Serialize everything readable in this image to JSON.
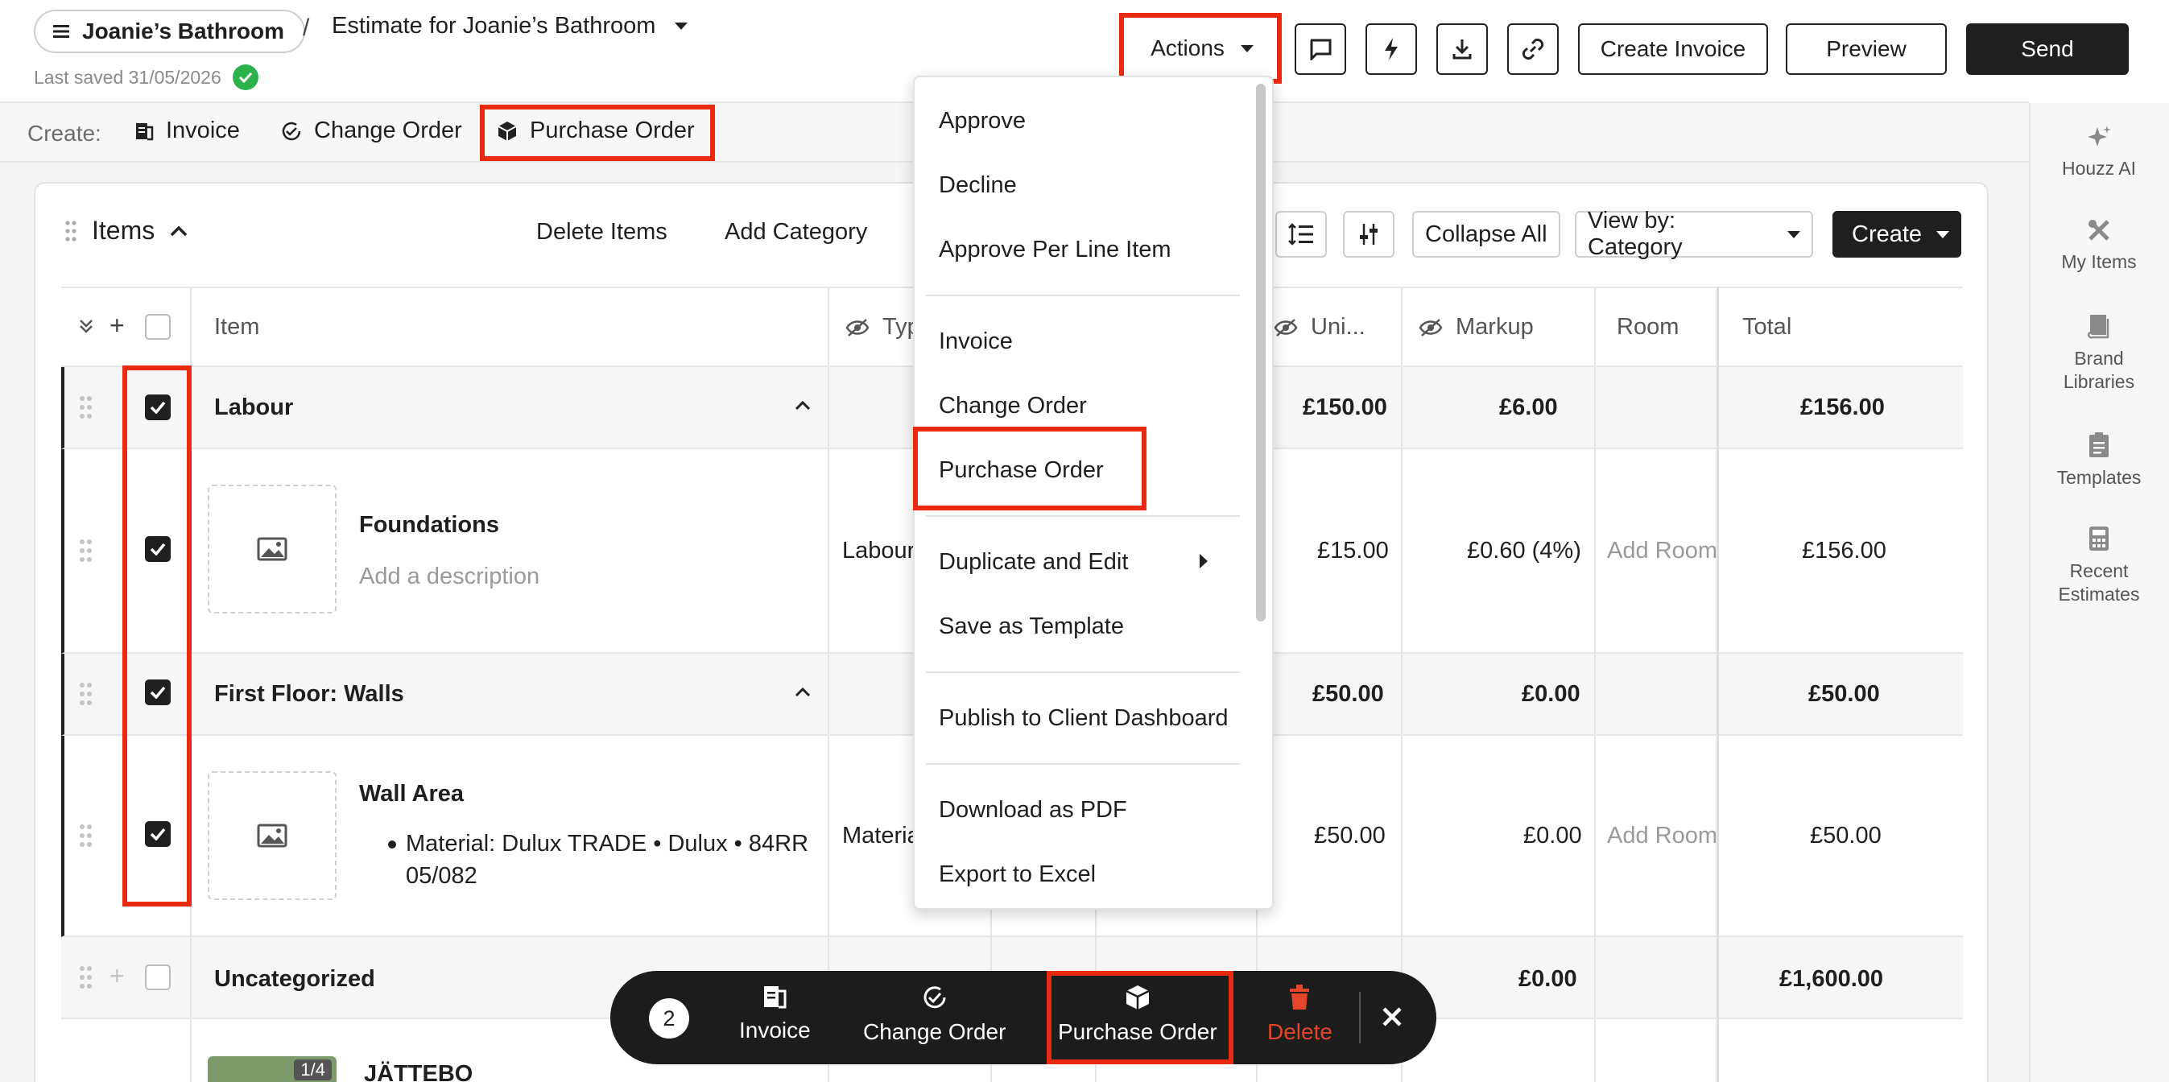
{
  "header": {
    "project_name": "Joanie’s Bathroom",
    "breadcrumb_sep": "/",
    "estimate_title": "Estimate for Joanie’s Bathroom",
    "last_saved": "Last saved 31/05/2026",
    "actions_label": "Actions",
    "create_invoice_label": "Create Invoice",
    "preview_label": "Preview",
    "send_label": "Send"
  },
  "create_row": {
    "label": "Create:",
    "invoice": "Invoice",
    "change_order": "Change Order",
    "purchase_order": "Purchase Order"
  },
  "rail": {
    "houzz_ai": "Houzz AI",
    "my_items": "My Items",
    "brand_libraries_1": "Brand",
    "brand_libraries_2": "Libraries",
    "templates": "Templates",
    "recent_estimates_1": "Recent",
    "recent_estimates_2": "Estimates"
  },
  "items_toolbar": {
    "title": "Items",
    "delete_items": "Delete Items",
    "add_category": "Add Category",
    "collapse_all": "Collapse All",
    "view_by": "View by: Category",
    "create": "Create"
  },
  "columns": {
    "item": "Item",
    "type": "Typ",
    "unit": "Uni...",
    "markup": "Markup",
    "room": "Room",
    "total": "Total"
  },
  "rows": {
    "labour": {
      "name": "Labour",
      "unit": "£150.00",
      "markup": "£6.00",
      "total": "£156.00"
    },
    "foundations": {
      "name": "Foundations",
      "desc": "Add a description",
      "type": "Labour",
      "unit": "£15.00",
      "markup": "£0.60 (4%)",
      "room": "Add Room",
      "total": "£156.00"
    },
    "first_floor": {
      "name": "First Floor: Walls",
      "unit": "£50.00",
      "markup": "£0.00",
      "total": "£50.00"
    },
    "wall_area": {
      "name": "Wall Area",
      "bullet_1": "Material: Dulux TRADE • Dulux • 84RR",
      "bullet_2": "05/082",
      "type": "Materia",
      "unit": "£50.00",
      "markup": "£0.00",
      "room": "Add Room",
      "total": "£50.00"
    },
    "uncategorized": {
      "name": "Uncategorized",
      "markup": "£0.00",
      "total": "£1,600.00"
    },
    "jattebo": {
      "name": "JÄTTEBO",
      "badge": "1/4"
    }
  },
  "actions_menu": {
    "items": [
      "Approve",
      "Decline",
      "Approve Per Line Item",
      "Invoice",
      "Change Order",
      "Purchase Order",
      "Duplicate and Edit",
      "Save as Template",
      "Publish to Client Dashboard",
      "Download as PDF",
      "Export to Excel"
    ]
  },
  "bulk_bar": {
    "count": "2",
    "invoice": "Invoice",
    "change_order": "Change Order",
    "purchase_order": "Purchase Order",
    "delete": "Delete"
  },
  "colors": {
    "highlight": "#ea2a10",
    "dark": "#1f1f1f",
    "success": "#2bb24c",
    "danger": "#e5452b"
  }
}
